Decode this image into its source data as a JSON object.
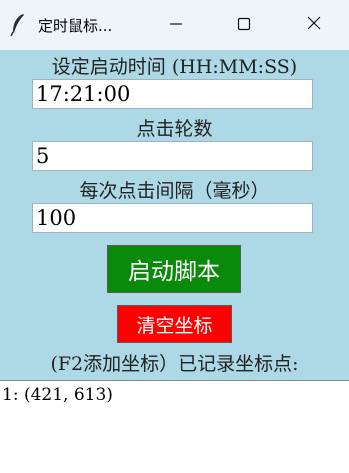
{
  "window": {
    "title": "定时鼠标...",
    "app_icon": "feather-icon",
    "controls": [
      "minimize-icon",
      "maximize-icon",
      "close-icon"
    ]
  },
  "form": {
    "start_time_label": "设定启动时间 (HH:MM:SS)",
    "start_time_value": "17:21:00",
    "rounds_label": "点击轮数",
    "rounds_value": "5",
    "interval_label": "每次点击间隔（毫秒）",
    "interval_value": "100"
  },
  "buttons": {
    "start_label": "启动脚本",
    "clear_label": "清空坐标"
  },
  "coords": {
    "header": "(F2添加坐标）已记录坐标点:",
    "items": [
      "1: (421, 613)"
    ]
  },
  "colors": {
    "background": "#add8e6",
    "start_button": "#0a8a0a",
    "clear_button": "#ff0000"
  }
}
